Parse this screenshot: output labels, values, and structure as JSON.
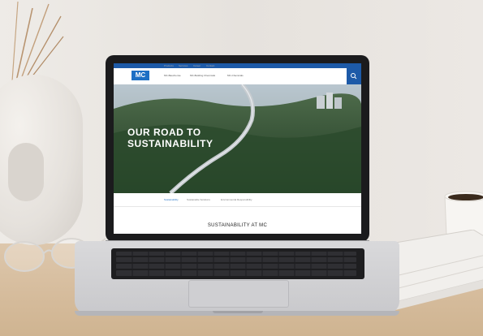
{
  "website": {
    "logo": "MC",
    "nav_items": [
      "MC-Bauchemie",
      "MC-Building Chemicals",
      "Products",
      "Services",
      "Career",
      "Contact"
    ],
    "menu_items": [
      "MC-Bauchemie",
      "MC-Bauchemie",
      "MC-Building Chemicals",
      "MC-Building Chemicals",
      "MC-Chemicals",
      "MC-Bauchemie"
    ],
    "hero_headline_line1": "OUR ROAD TO",
    "hero_headline_line2": "SUSTAINABILITY",
    "subnav_items": [
      "Sustainability",
      "Sustainable Solutions",
      "Environmental Responsibility"
    ],
    "section_title": "SUSTAINABILITY AT MC"
  },
  "colors": {
    "brand_blue": "#1d6fc4",
    "dark_blue": "#1d5aa8",
    "laptop_bezel": "#1b1b1d",
    "desk": "#d5bb9b",
    "wall": "#e9e6e2"
  }
}
